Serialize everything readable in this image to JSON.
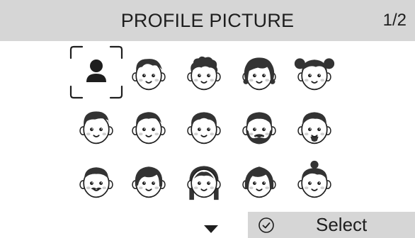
{
  "header": {
    "title": "PROFILE PICTURE",
    "page_indicator": "1/2"
  },
  "avatars": [
    {
      "name": "avatar-placeholder",
      "selected": true,
      "hair": "none"
    },
    {
      "name": "avatar-man-swept-hair",
      "selected": false,
      "hair": "swept"
    },
    {
      "name": "avatar-curly-hair",
      "selected": false,
      "hair": "curly"
    },
    {
      "name": "avatar-girl-curly-bob",
      "selected": false,
      "hair": "curly-bob"
    },
    {
      "name": "avatar-girl-pigtails",
      "selected": false,
      "hair": "pigtails"
    },
    {
      "name": "avatar-man-side-part",
      "selected": false,
      "hair": "sidepart"
    },
    {
      "name": "avatar-man-short-hair",
      "selected": false,
      "hair": "short"
    },
    {
      "name": "avatar-man-neat-hair",
      "selected": false,
      "hair": "neat"
    },
    {
      "name": "avatar-man-beard",
      "selected": false,
      "hair": "beard"
    },
    {
      "name": "avatar-man-goatee",
      "selected": false,
      "hair": "goatee"
    },
    {
      "name": "avatar-man-mustache",
      "selected": false,
      "hair": "mustache"
    },
    {
      "name": "avatar-woman-short-hair",
      "selected": false,
      "hair": "woman-short"
    },
    {
      "name": "avatar-woman-long-hair",
      "selected": false,
      "hair": "woman-long"
    },
    {
      "name": "avatar-woman-bob",
      "selected": false,
      "hair": "bob"
    },
    {
      "name": "avatar-woman-bun",
      "selected": false,
      "hair": "bun"
    }
  ],
  "footer": {
    "next_page_icon": "triangle-down-icon",
    "select_icon": "check-circle-icon",
    "select_label": "Select"
  },
  "colors": {
    "header_bg": "#d6d6d6",
    "text": "#1e1e1e",
    "skin": "#ffffff",
    "hair": "#333333",
    "blush": "#cfcfcf"
  }
}
